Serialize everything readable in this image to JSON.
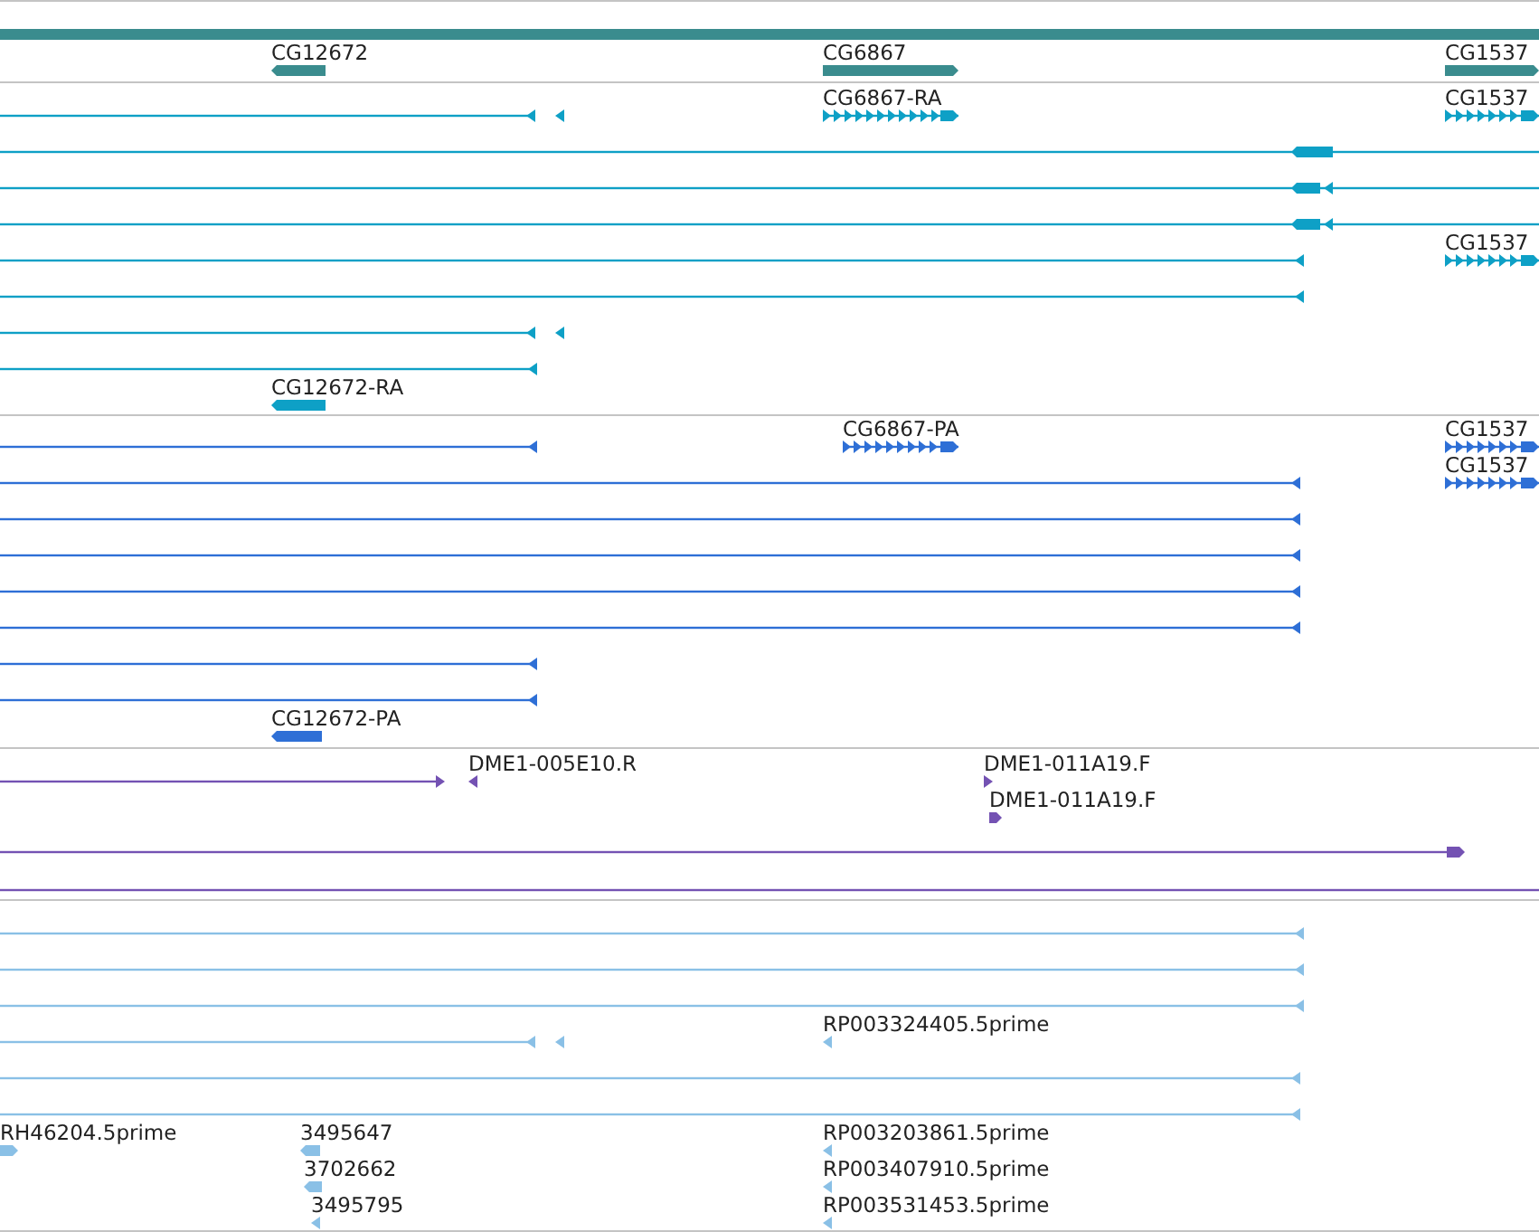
{
  "tracks": [
    {
      "color": "#3a8c8e",
      "features": [
        {
          "arrow": false
        },
        {
          "label": "CG12672",
          "reverse": true
        },
        {
          "label": "CG6867",
          "reverse": false
        },
        {
          "label": "CG1537",
          "reverse": false
        }
      ]
    },
    {
      "color": "#0ea0c6",
      "features": [
        {
          "reverse": true
        },
        {
          "label": "CG6867-RA",
          "reverse": false
        },
        {
          "label": "CG1537",
          "reverse": false
        },
        {
          "reverse": true
        },
        {
          "reverse": true
        },
        {
          "reverse": true
        },
        {
          "label": "CG1537",
          "reverse": false
        },
        {
          "reverse": true
        },
        {
          "reverse": true
        },
        {
          "reverse": true
        },
        {
          "reverse": true
        },
        {
          "label": "CG12672-RA",
          "reverse": true
        }
      ]
    },
    {
      "color": "#2e6fd6",
      "features": [
        {
          "reverse": true
        },
        {
          "label": "CG6867-PA",
          "reverse": false
        },
        {
          "label": "CG1537",
          "reverse": false
        },
        {
          "reverse": true
        },
        {
          "label": "CG1537",
          "reverse": false
        },
        {
          "reverse": true
        },
        {
          "reverse": true
        },
        {
          "reverse": true
        },
        {
          "reverse": true
        },
        {
          "reverse": true
        },
        {
          "reverse": true
        },
        {
          "label": "CG12672-PA",
          "reverse": true
        }
      ]
    },
    {
      "color": "#7452b3",
      "features": [
        {
          "reverse": false
        },
        {
          "label": "DME1-005E10.R",
          "reverse": true
        },
        {
          "label": "DME1-011A19.F",
          "reverse": false
        },
        {
          "label": "DME1-011A19.F",
          "reverse": false
        },
        {
          "reverse": false
        },
        {
          "arrow": false
        }
      ]
    },
    {
      "color": "#8ac0e6",
      "features": [
        {
          "reverse": true
        },
        {
          "reverse": true
        },
        {
          "reverse": true
        },
        {
          "reverse": true
        },
        {
          "label": "RP003324405.5prime",
          "reverse": true
        },
        {
          "reverse": true
        },
        {
          "reverse": true
        },
        {
          "label": "RH46204.5prime",
          "reverse": false
        },
        {
          "label": "3495647",
          "reverse": true
        },
        {
          "label": "RP003203861.5prime",
          "reverse": true
        },
        {
          "label": "3702662",
          "reverse": true
        },
        {
          "label": "RP003407910.5prime",
          "reverse": true
        },
        {
          "label": "3495795",
          "reverse": true
        },
        {
          "label": "RP003531453.5prime",
          "reverse": true
        }
      ]
    }
  ]
}
